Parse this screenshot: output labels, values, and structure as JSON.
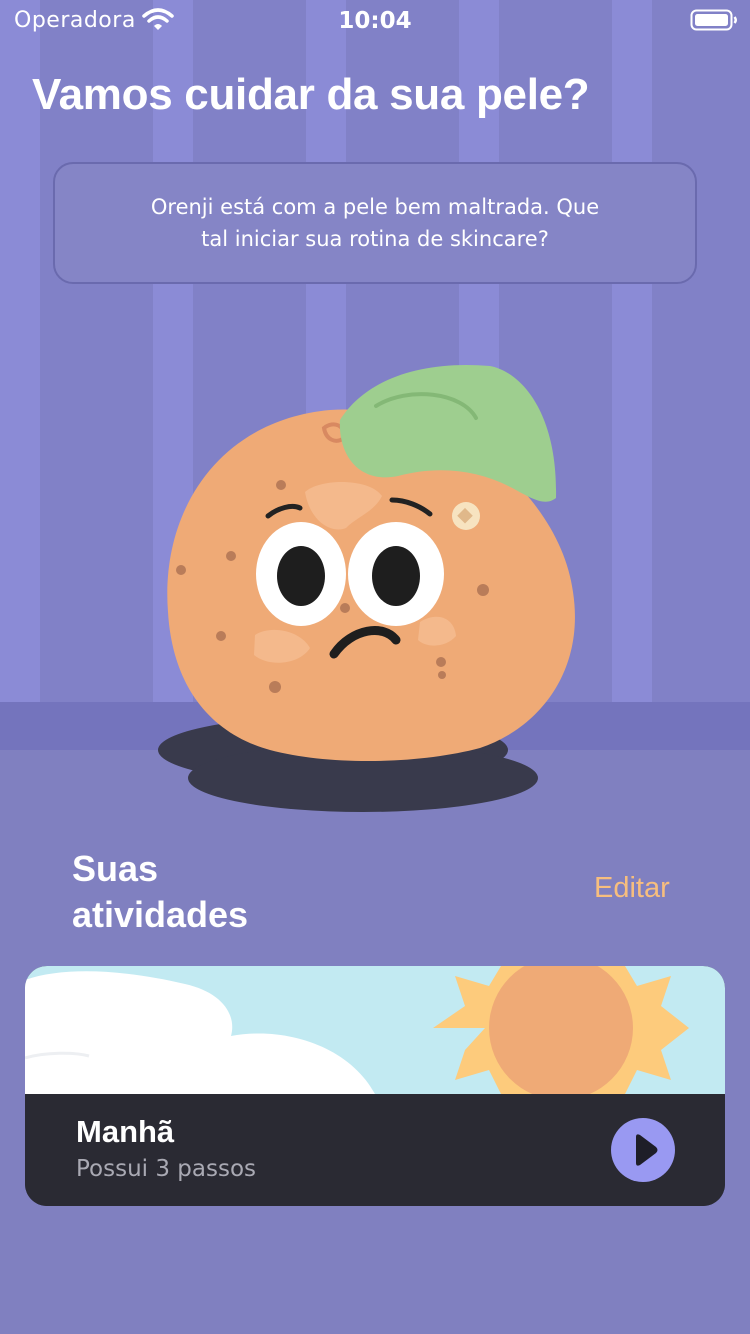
{
  "status_bar": {
    "carrier": "Operadora",
    "time": "10:04"
  },
  "header": {
    "title": "Vamos cuidar da sua pele?"
  },
  "message": {
    "text": "Orenji está com a pele bem maltrada. Que tal iniciar sua rotina de skincare?"
  },
  "mascot": {
    "icon": "orange-mascot-icon",
    "mood": "sad"
  },
  "activities": {
    "title": "Suas atividades",
    "edit_label": "Editar",
    "items": [
      {
        "title": "Manhã",
        "subtitle": "Possui 3 passos",
        "art": [
          "cloud-icon",
          "sun-icon"
        ],
        "action_icon": "play-icon"
      }
    ]
  },
  "colors": {
    "wall": "#8B8BD6",
    "floor": "#8080C0",
    "accent": "#F7BE7E",
    "card_dark": "#2A2A33",
    "play_button": "#9999F2",
    "mascot_orange": "#EFAA76",
    "leaf": "#9ECE8F"
  }
}
